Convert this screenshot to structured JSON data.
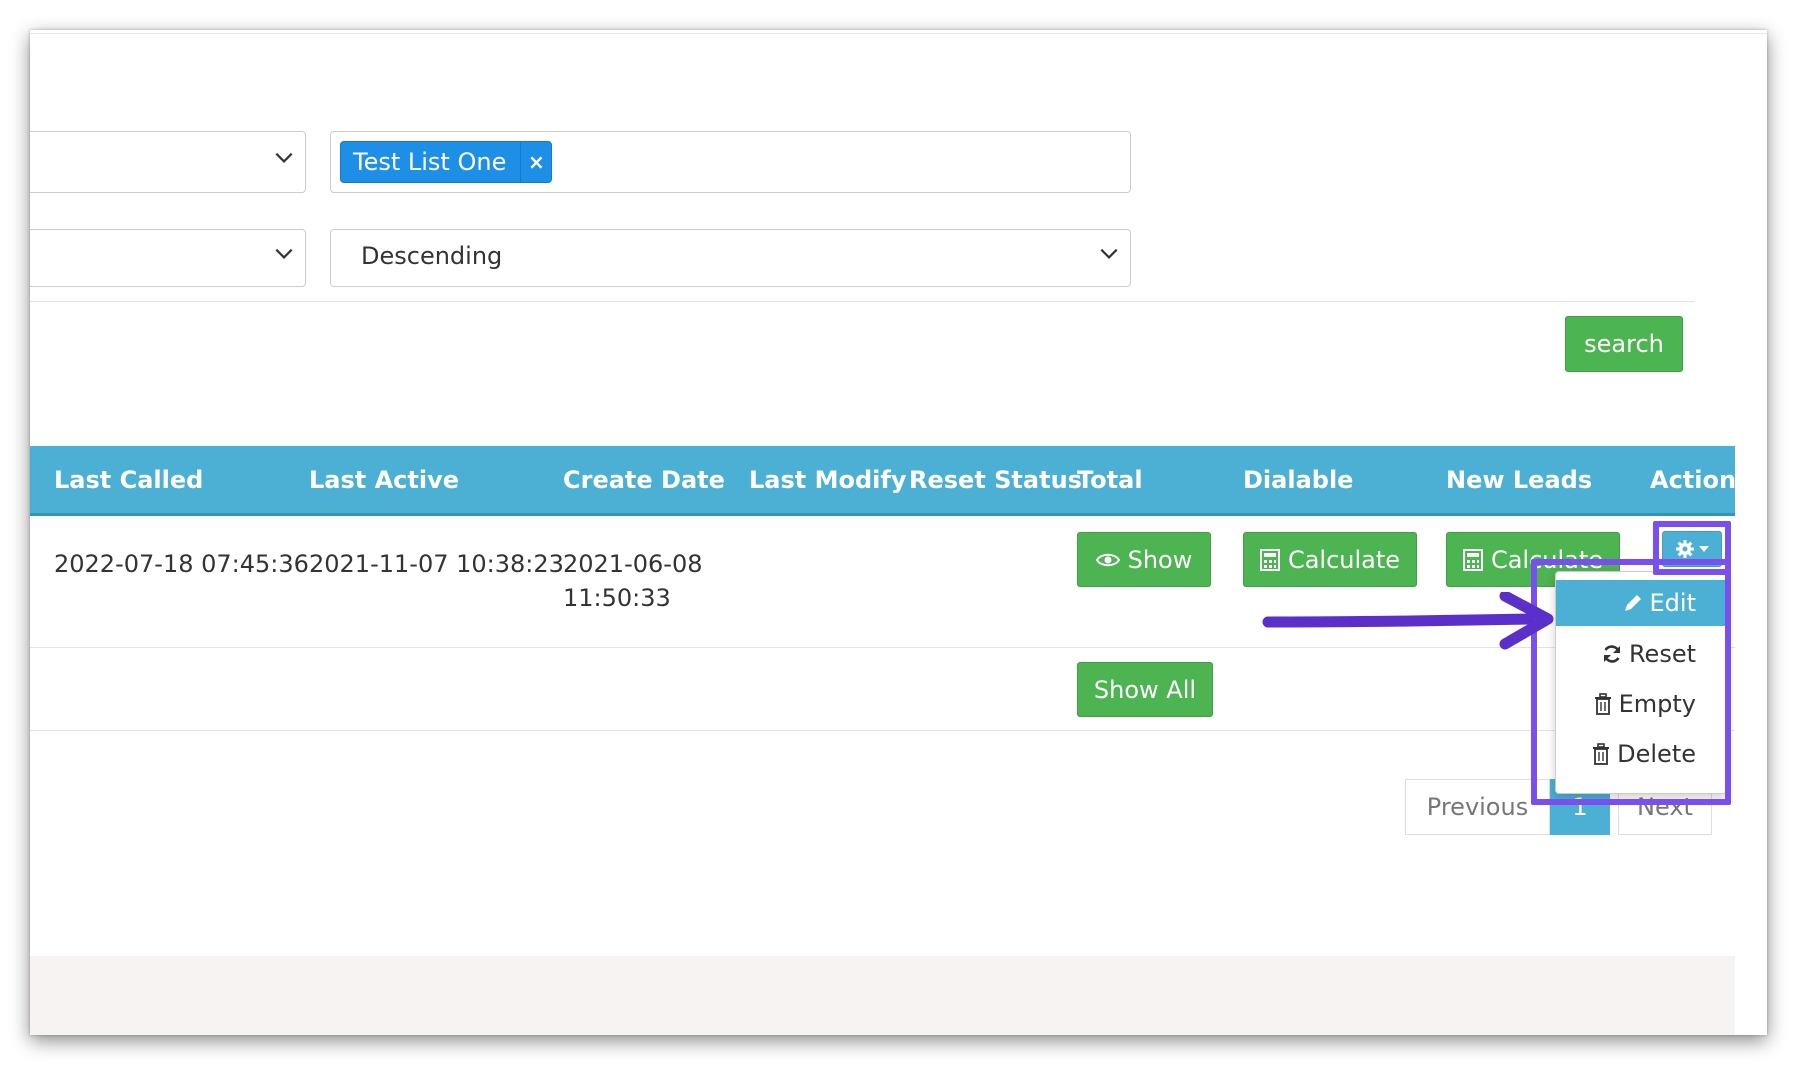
{
  "filters": {
    "list_select": {
      "value": ""
    },
    "selected_lists": [
      {
        "label": "Test List One",
        "remove": "×"
      }
    ],
    "sort_field_select": {
      "value": ""
    },
    "sort_order_select": {
      "value": "Descending"
    },
    "search_label": "search"
  },
  "table": {
    "columns": [
      "Last Called",
      "Last Active",
      "Create Date",
      "Last Modify",
      "Reset Status",
      "Total",
      "Dialable",
      "New Leads",
      "Action"
    ],
    "rows": [
      {
        "last_called": "2022-07-18 07:45:36",
        "last_active": "2021-11-07 10:38:23",
        "create_date_line1": "2021-06-08",
        "create_date_line2": "11:50:33",
        "last_modify": "",
        "reset_status": "",
        "total_label": "Show",
        "dialable_label": "Calculate",
        "new_leads_label": "Calculate"
      }
    ],
    "show_all_label": "Show All"
  },
  "action_menu": {
    "items": [
      {
        "label": "Edit",
        "icon": "pencil-icon",
        "active": true
      },
      {
        "label": "Reset",
        "icon": "refresh-icon"
      },
      {
        "label": "Empty",
        "icon": "trash-icon"
      },
      {
        "label": "Delete",
        "icon": "trash-icon"
      }
    ]
  },
  "pagination": {
    "previous": "Previous",
    "current": "1",
    "next": "Next"
  },
  "annotation": {
    "highlight_color": "#7a4ff0"
  },
  "colors": {
    "header": "#4bb0d3",
    "success": "#4cb450",
    "tag": "#1e8fe6"
  }
}
